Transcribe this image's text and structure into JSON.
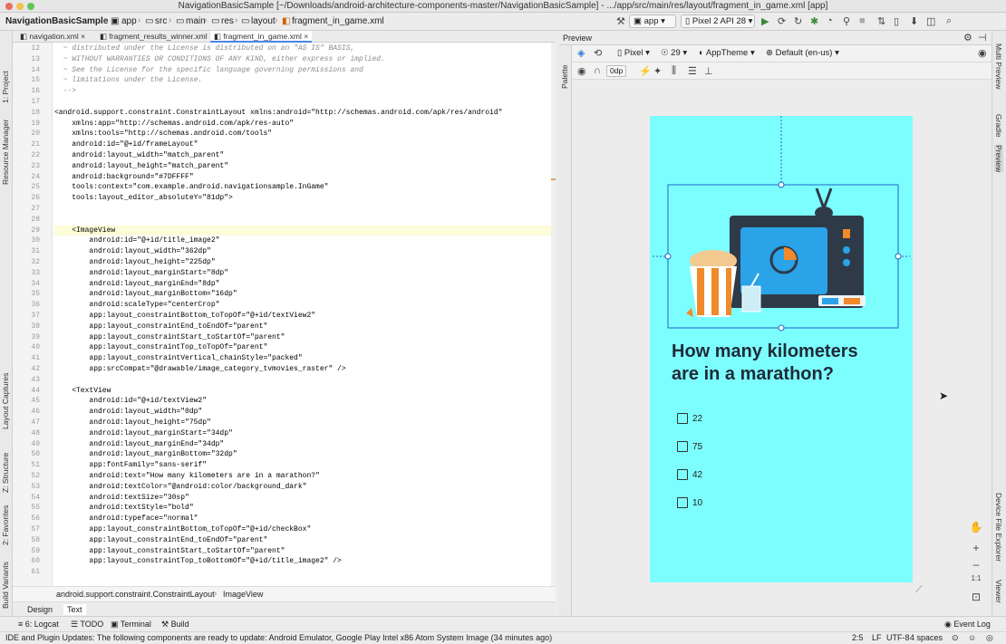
{
  "window": {
    "title": "NavigationBasicSample [~/Downloads/android-architecture-components-master/NavigationBasicSample] - .../app/src/main/res/layout/fragment_in_game.xml [app]"
  },
  "breadcrumbs": [
    "NavigationBasicSample",
    "app",
    "src",
    "main",
    "res",
    "layout",
    "fragment_in_game.xml"
  ],
  "toolbar": {
    "module": "app",
    "device": "Pixel 2 API 28"
  },
  "left_tools": [
    "1: Project",
    "Resource Manager",
    "Layout Captures",
    "Z: Structure",
    "2: Favorites",
    "Build Variants"
  ],
  "right_tools": [
    "Multi Preview",
    "Gradle",
    "Preview",
    "Device File Explorer",
    "Viewer"
  ],
  "editor_tabs": [
    "navigation.xml",
    "fragment_results_winner.xml",
    "fragment_in_game.xml"
  ],
  "code_lines": [
    {
      "n": "12",
      "t": "  ~ distributed under the License is distributed on an \"AS IS\" BASIS,",
      "c": "cm"
    },
    {
      "n": "13",
      "t": "  ~ WITHOUT WARRANTIES OR CONDITIONS OF ANY KIND, either express or implied.",
      "c": "cm"
    },
    {
      "n": "14",
      "t": "  ~ See the License for the specific language governing permissions and",
      "c": "cm"
    },
    {
      "n": "15",
      "t": "  ~ limitations under the License.",
      "c": "cm"
    },
    {
      "n": "16",
      "t": "  -->",
      "c": "cm"
    },
    {
      "n": "17",
      "t": "",
      "c": ""
    },
    {
      "n": "18",
      "t": "<android.support.constraint.ConstraintLayout xmlns:android=\"http://schemas.android.com/apk/res/android\"",
      "c": ""
    },
    {
      "n": "19",
      "t": "    xmlns:app=\"http://schemas.android.com/apk/res-auto\"",
      "c": ""
    },
    {
      "n": "20",
      "t": "    xmlns:tools=\"http://schemas.android.com/tools\"",
      "c": ""
    },
    {
      "n": "21",
      "t": "    android:id=\"@+id/frameLayout\"",
      "c": ""
    },
    {
      "n": "22",
      "t": "    android:layout_width=\"match_parent\"",
      "c": ""
    },
    {
      "n": "23",
      "t": "    android:layout_height=\"match_parent\"",
      "c": ""
    },
    {
      "n": "24",
      "t": "    android:background=\"#7DFFFF\"",
      "c": ""
    },
    {
      "n": "25",
      "t": "    tools:context=\"com.example.android.navigationsample.InGame\"",
      "c": ""
    },
    {
      "n": "26",
      "t": "    tools:layout_editor_absoluteY=\"81dp\">",
      "c": ""
    },
    {
      "n": "27",
      "t": "",
      "c": ""
    },
    {
      "n": "28",
      "t": "",
      "c": ""
    },
    {
      "n": "29",
      "t": "    <ImageView",
      "c": "hl"
    },
    {
      "n": "30",
      "t": "        android:id=\"@+id/title_image2\"",
      "c": ""
    },
    {
      "n": "31",
      "t": "        android:layout_width=\"362dp\"",
      "c": ""
    },
    {
      "n": "32",
      "t": "        android:layout_height=\"225dp\"",
      "c": ""
    },
    {
      "n": "33",
      "t": "        android:layout_marginStart=\"8dp\"",
      "c": ""
    },
    {
      "n": "34",
      "t": "        android:layout_marginEnd=\"8dp\"",
      "c": ""
    },
    {
      "n": "35",
      "t": "        android:layout_marginBottom=\"16dp\"",
      "c": ""
    },
    {
      "n": "36",
      "t": "        android:scaleType=\"centerCrop\"",
      "c": ""
    },
    {
      "n": "37",
      "t": "        app:layout_constraintBottom_toTopOf=\"@+id/textView2\"",
      "c": ""
    },
    {
      "n": "38",
      "t": "        app:layout_constraintEnd_toEndOf=\"parent\"",
      "c": ""
    },
    {
      "n": "39",
      "t": "        app:layout_constraintStart_toStartOf=\"parent\"",
      "c": ""
    },
    {
      "n": "40",
      "t": "        app:layout_constraintTop_toTopOf=\"parent\"",
      "c": ""
    },
    {
      "n": "41",
      "t": "        app:layout_constraintVertical_chainStyle=\"packed\"",
      "c": ""
    },
    {
      "n": "42",
      "t": "        app:srcCompat=\"@drawable/image_category_tvmovies_raster\" />",
      "c": ""
    },
    {
      "n": "43",
      "t": "",
      "c": ""
    },
    {
      "n": "44",
      "t": "    <TextView",
      "c": ""
    },
    {
      "n": "45",
      "t": "        android:id=\"@+id/textView2\"",
      "c": ""
    },
    {
      "n": "46",
      "t": "        android:layout_width=\"0dp\"",
      "c": ""
    },
    {
      "n": "47",
      "t": "        android:layout_height=\"75dp\"",
      "c": ""
    },
    {
      "n": "48",
      "t": "        android:layout_marginStart=\"34dp\"",
      "c": ""
    },
    {
      "n": "49",
      "t": "        android:layout_marginEnd=\"34dp\"",
      "c": ""
    },
    {
      "n": "50",
      "t": "        android:layout_marginBottom=\"32dp\"",
      "c": ""
    },
    {
      "n": "51",
      "t": "        app:fontFamily=\"sans-serif\"",
      "c": ""
    },
    {
      "n": "52",
      "t": "        android:text=\"How many kilometers are in a marathon?\"",
      "c": ""
    },
    {
      "n": "53",
      "t": "        android:textColor=\"@android:color/background_dark\"",
      "c": ""
    },
    {
      "n": "54",
      "t": "        android:textSize=\"30sp\"",
      "c": ""
    },
    {
      "n": "55",
      "t": "        android:textStyle=\"bold\"",
      "c": ""
    },
    {
      "n": "56",
      "t": "        android:typeface=\"normal\"",
      "c": ""
    },
    {
      "n": "57",
      "t": "        app:layout_constraintBottom_toTopOf=\"@+id/checkBox\"",
      "c": ""
    },
    {
      "n": "58",
      "t": "        app:layout_constraintEnd_toEndOf=\"parent\"",
      "c": ""
    },
    {
      "n": "59",
      "t": "        app:layout_constraintStart_toStartOf=\"parent\"",
      "c": ""
    },
    {
      "n": "60",
      "t": "        app:layout_constraintTop_toBottomOf=\"@+id/title_image2\" />",
      "c": ""
    },
    {
      "n": "61",
      "t": "",
      "c": ""
    }
  ],
  "editor_breadcrumb": [
    "android.support.constraint.ConstraintLayout",
    "ImageView"
  ],
  "design_tabs": [
    "Design",
    "Text"
  ],
  "preview": {
    "title": "Preview",
    "device": "Pixel",
    "api": "29",
    "theme": "AppTheme",
    "locale": "Default (en-us)",
    "margin": "0dp",
    "palette_label": "Palette"
  },
  "phone": {
    "background": "#7DFFFF",
    "question": "How many kilometers are in a marathon?",
    "options": [
      "22",
      "75",
      "42",
      "10"
    ]
  },
  "zoom": {
    "ratio": "1:1"
  },
  "bottom_tabs": [
    "6: Logcat",
    "TODO",
    "Terminal",
    "Build"
  ],
  "event_log": "Event Log",
  "message": "IDE and Plugin Updates: The following components are ready to update: Android Emulator, Google Play Intel x86 Atom System Image (34 minutes ago)",
  "status": {
    "position": "2:5",
    "line_sep": "LF",
    "encoding": "UTF-8",
    "indent": "4 spaces"
  }
}
